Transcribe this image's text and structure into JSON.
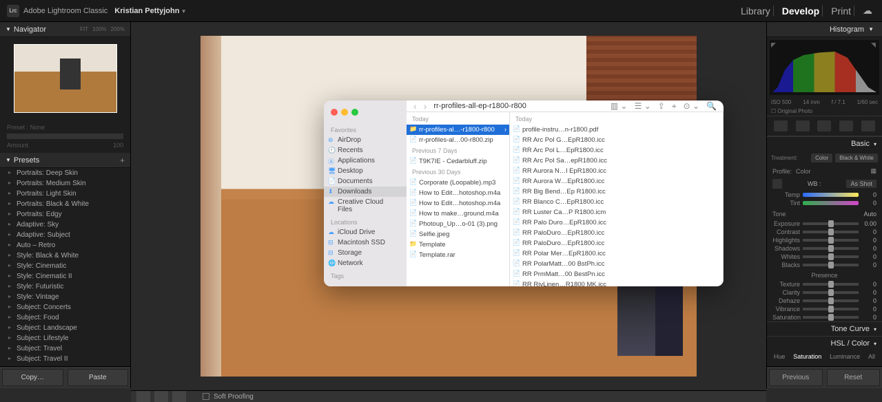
{
  "topbar": {
    "logo": "Lrc",
    "app": "Adobe Lightroom Classic",
    "user": "Kristian Pettyjohn",
    "modules": {
      "library": "Library",
      "develop": "Develop",
      "print": "Print"
    }
  },
  "left": {
    "navigator": {
      "title": "Navigator",
      "mode": "FIT",
      "zoom1": "100%",
      "zoom2": "200%"
    },
    "preset_label": "Preset : None",
    "amount_label": "Amount",
    "amount_value": "100",
    "presets": {
      "title": "Presets",
      "items": [
        "Portraits: Deep Skin",
        "Portraits: Medium Skin",
        "Portraits: Light Skin",
        "Portraits: Black & White",
        "Portraits: Edgy",
        "Adaptive: Sky",
        "Adaptive: Subject",
        "Auto – Retro",
        "Style: Black & White",
        "Style: Cinematic",
        "Style: Cinematic II",
        "Style: Futuristic",
        "Style: Vintage",
        "Subject: Concerts",
        "Subject: Food",
        "Subject: Landscape",
        "Subject: Lifestyle",
        "Subject: Travel",
        "Subject: Travel II"
      ]
    },
    "copy": "Copy…",
    "paste": "Paste"
  },
  "center": {
    "soft_proofing": "Soft Proofing"
  },
  "finder": {
    "title": "rr-profiles-all-ep-r1800-r800",
    "sidebar": {
      "favorites_hdr": "Favorites",
      "favorites": [
        "AirDrop",
        "Recents",
        "Applications",
        "Desktop",
        "Documents",
        "Downloads",
        "Creative Cloud Files"
      ],
      "selected_fav": "Downloads",
      "locations_hdr": "Locations",
      "locations": [
        "iCloud Drive",
        "Macintosh SSD",
        "Storage",
        "Network"
      ],
      "tags_hdr": "Tags"
    },
    "col1": {
      "today": "Today",
      "today_items": [
        "rr-profiles-al…-r1800-r800",
        "rr-profiles-al…00-r800.zip"
      ],
      "selected": "rr-profiles-al…-r1800-r800",
      "prev7": "Previous 7 Days",
      "prev7_items": [
        "T9K7IE - Cedarbluff.zip"
      ],
      "prev30": "Previous 30 Days",
      "prev30_items": [
        "Corporate (Loopable).mp3",
        "How to Edit…hotoshop.m4a",
        "How to Edit…hotoshop.m4a",
        "How to make…ground.m4a",
        "Photoup_Up…o-01 (3).png",
        "Selfie.jpeg",
        "Template",
        "Template.rar"
      ]
    },
    "col2": {
      "today": "Today",
      "items": [
        "profile-instru…n-r1800.pdf",
        "RR Arc Pol G…EpR1800.icc",
        "RR Arc Pol L…EpR1800.icc",
        "RR Arc Pol Sa…epR1800.icc",
        "RR Aurora N…l EpR1800.icc",
        "RR Aurora W…EpR1800.icc",
        "RR Big Bend…Ep R1800.icc",
        "RR Blanco C…EpR1800.icc",
        "RR Luster Ca…P R1800.icm",
        "RR Palo Duro…EpR1800.icc",
        "RR PaloDuro…EpR1800.icc",
        "RR PaloDuro…EpR1800.icc",
        "RR Polar Mer…EpR1800.icc",
        "RR PolarMatt…00 BstPh.icc",
        "RR PrmMatt…00 BestPn.icc",
        "RR RivLinen…R1800 MK.icc"
      ]
    }
  },
  "right": {
    "histogram": "Histogram",
    "histo_info": {
      "iso": "ISO 500",
      "focal": "14 mm",
      "aperture": "f / 7.1",
      "shutter": "1/60 sec"
    },
    "original": "Original Photo",
    "basic": "Basic",
    "treatment_lbl": "Treatment:",
    "color_opt": "Color",
    "bw_opt": "Black & White",
    "profile_lbl": "Profile:",
    "profile_val": "Color",
    "wb_lbl": "WB :",
    "wb_val": "As Shot",
    "temp": "Temp",
    "tint": "Tint",
    "tone_hdr": "Tone",
    "auto": "Auto",
    "sliders": {
      "exposure": {
        "lbl": "Exposure",
        "val": "0.00"
      },
      "contrast": {
        "lbl": "Contrast",
        "val": "0"
      },
      "highlights": {
        "lbl": "Highlights",
        "val": "0"
      },
      "shadows": {
        "lbl": "Shadows",
        "val": "0"
      },
      "whites": {
        "lbl": "Whites",
        "val": "0"
      },
      "blacks": {
        "lbl": "Blacks",
        "val": "0"
      },
      "texture": {
        "lbl": "Texture",
        "val": "0"
      },
      "clarity": {
        "lbl": "Clarity",
        "val": "0"
      },
      "dehaze": {
        "lbl": "Dehaze",
        "val": "0"
      },
      "vibrance": {
        "lbl": "Vibrance",
        "val": "0"
      },
      "saturation": {
        "lbl": "Saturation",
        "val": "0"
      }
    },
    "presence": "Presence",
    "tone_curve": "Tone Curve",
    "hsl": "HSL / Color",
    "hsl_tabs": {
      "hue": "Hue",
      "sat": "Saturation",
      "lum": "Luminance",
      "all": "All"
    },
    "previous": "Previous",
    "reset": "Reset",
    "zero": "0"
  }
}
